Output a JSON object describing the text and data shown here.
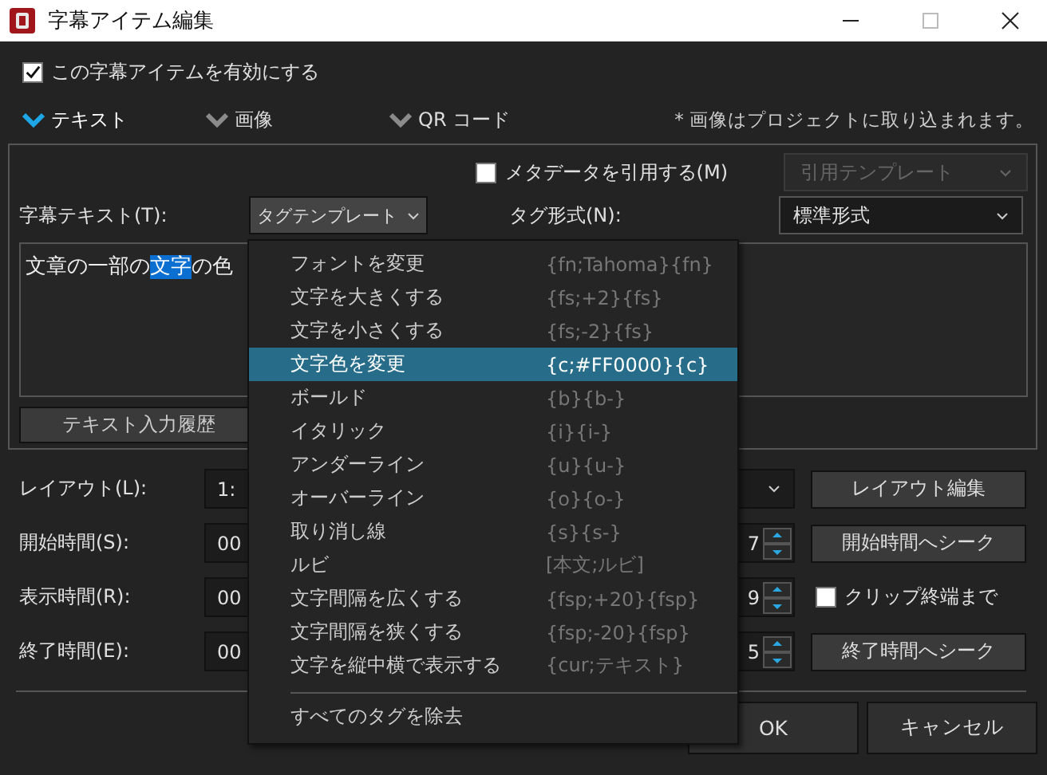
{
  "window": {
    "title": "字幕アイテム編集"
  },
  "enable": {
    "label": "この字幕アイテムを有効にする",
    "checked": true
  },
  "sections": [
    {
      "label": "テキスト",
      "selected": true
    },
    {
      "label": "画像",
      "selected": false
    },
    {
      "label": "QR コード",
      "selected": false
    }
  ],
  "note": "* 画像はプロジェクトに取り込まれます。",
  "metadata": {
    "label": "メタデータを引用する(M)",
    "checked": false
  },
  "cite_template": {
    "label": "引用テンプレート",
    "disabled": true
  },
  "subtitle_label": "字幕テキスト(T):",
  "tag_template": {
    "label": "タグテンプレート"
  },
  "tag_format": {
    "label": "タグ形式(N):",
    "value": "標準形式"
  },
  "text": {
    "before": "文章の一部の",
    "selected": "文字",
    "after": "の色"
  },
  "history_button": "テキスト入力履歴",
  "rows": [
    {
      "kind": "select",
      "label": "レイアウト(L):",
      "value": "1:",
      "button": "レイアウト編集"
    },
    {
      "kind": "time",
      "label": "開始時間(S):",
      "value": "00",
      "value_end": "7",
      "button": "開始時間へシーク"
    },
    {
      "kind": "time",
      "label": "表示時間(R):",
      "value": "00",
      "value_end": "9",
      "checkbox": {
        "label": "クリップ終端まで",
        "checked": false
      }
    },
    {
      "kind": "time",
      "label": "終了時間(E):",
      "value": "00",
      "value_end": "5",
      "button": "終了時間へシーク"
    }
  ],
  "buttons": [
    "OK",
    "キャンセル"
  ],
  "menu": {
    "items": [
      {
        "label": "フォントを変更",
        "tag": "{fn;Tahoma}{fn}",
        "selected": false
      },
      {
        "label": "文字を大きくする",
        "tag": "{fs;+2}{fs}",
        "selected": false
      },
      {
        "label": "文字を小さくする",
        "tag": "{fs;-2}{fs}",
        "selected": false
      },
      {
        "label": "文字色を変更",
        "tag": "{c;#FF0000}{c}",
        "selected": true
      },
      {
        "label": "ボールド",
        "tag": "{b}{b-}",
        "selected": false
      },
      {
        "label": "イタリック",
        "tag": "{i}{i-}",
        "selected": false
      },
      {
        "label": "アンダーライン",
        "tag": "{u}{u-}",
        "selected": false
      },
      {
        "label": "オーバーライン",
        "tag": "{o}{o-}",
        "selected": false
      },
      {
        "label": "取り消し線",
        "tag": "{s}{s-}",
        "selected": false
      },
      {
        "label": "ルビ",
        "tag": "[本文;ルビ]",
        "selected": false
      },
      {
        "label": "文字間隔を広くする",
        "tag": "{fsp;+20}{fsp}",
        "selected": false
      },
      {
        "label": "文字間隔を狭くする",
        "tag": "{fsp;-20}{fsp}",
        "selected": false
      },
      {
        "label": "文字を縦中横で表示する",
        "tag": "{cur;テキスト}",
        "selected": false
      }
    ],
    "footer": "すべてのタグを除去"
  }
}
